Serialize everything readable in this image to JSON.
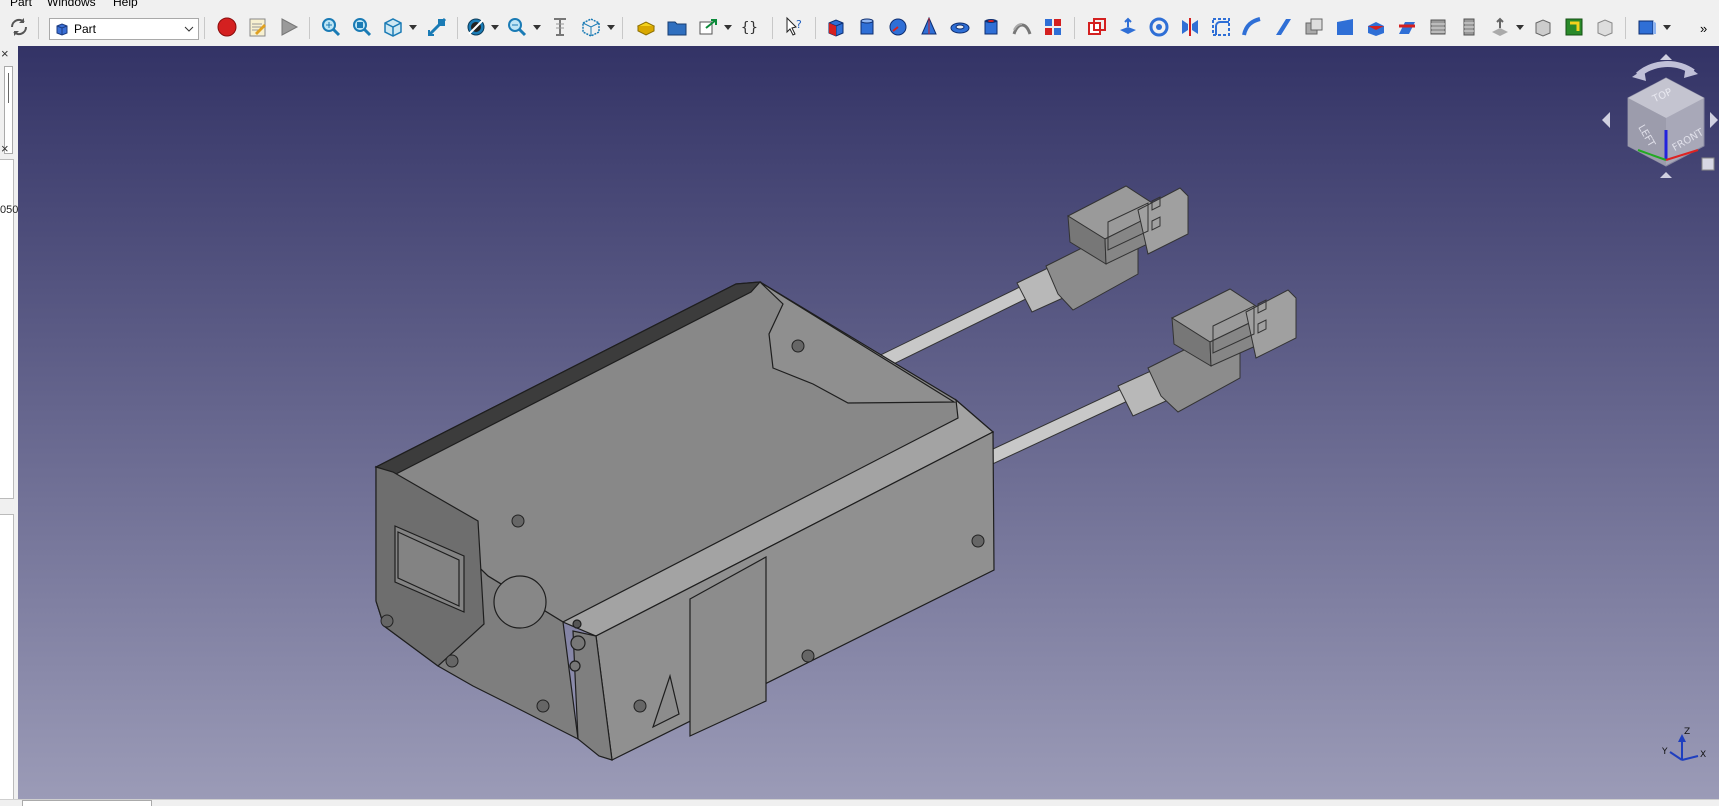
{
  "menubar": {
    "items": [
      "Part",
      "Windows",
      "Help"
    ]
  },
  "workbench": {
    "selected": "Part"
  },
  "toolbar": {
    "overflow_label": "»",
    "buttons": [
      "refresh-icon",
      "macro-record-icon",
      "macro-edit-icon",
      "macro-run-icon",
      "fit-all-icon",
      "fit-selection-icon",
      "view-isometric-icon",
      "measure-icon",
      "draw-style-icon",
      "zoom-box-icon",
      "clipping-plane-icon",
      "bounding-box-icon",
      "part-icon",
      "group-icon",
      "link-icon",
      "expression-icon",
      "whats-this-icon",
      "cube-icon",
      "cylinder-icon",
      "sphere-icon",
      "cone-icon",
      "torus-icon",
      "tube-icon",
      "primitives-icon",
      "shape-builder-icon",
      "boolean-icon",
      "extrude-icon",
      "revolve-icon",
      "mirror-icon",
      "fillet-icon",
      "chamfer-icon",
      "make-face-icon",
      "ruled-surface-icon",
      "loft-icon",
      "sweep-icon",
      "section-icon",
      "cross-sections-icon",
      "offset-icon",
      "thickness-icon",
      "projection-icon",
      "compound-icon",
      "check-geometry-icon",
      "box-selection-icon"
    ]
  },
  "left_panel": {
    "close_label": "×",
    "value_fragment": "050"
  },
  "navigation_cube": {
    "faces": [
      "TOP",
      "LEFT",
      "FRONT"
    ]
  },
  "axis_triad": {
    "x": "X",
    "y": "Y",
    "z": "Z"
  },
  "colors": {
    "viewport_top": "#333366",
    "viewport_bottom": "#9b9bb7",
    "model_face": "#8a8a8a",
    "record_red": "#d42020",
    "accent_blue": "#1f6fd1"
  }
}
